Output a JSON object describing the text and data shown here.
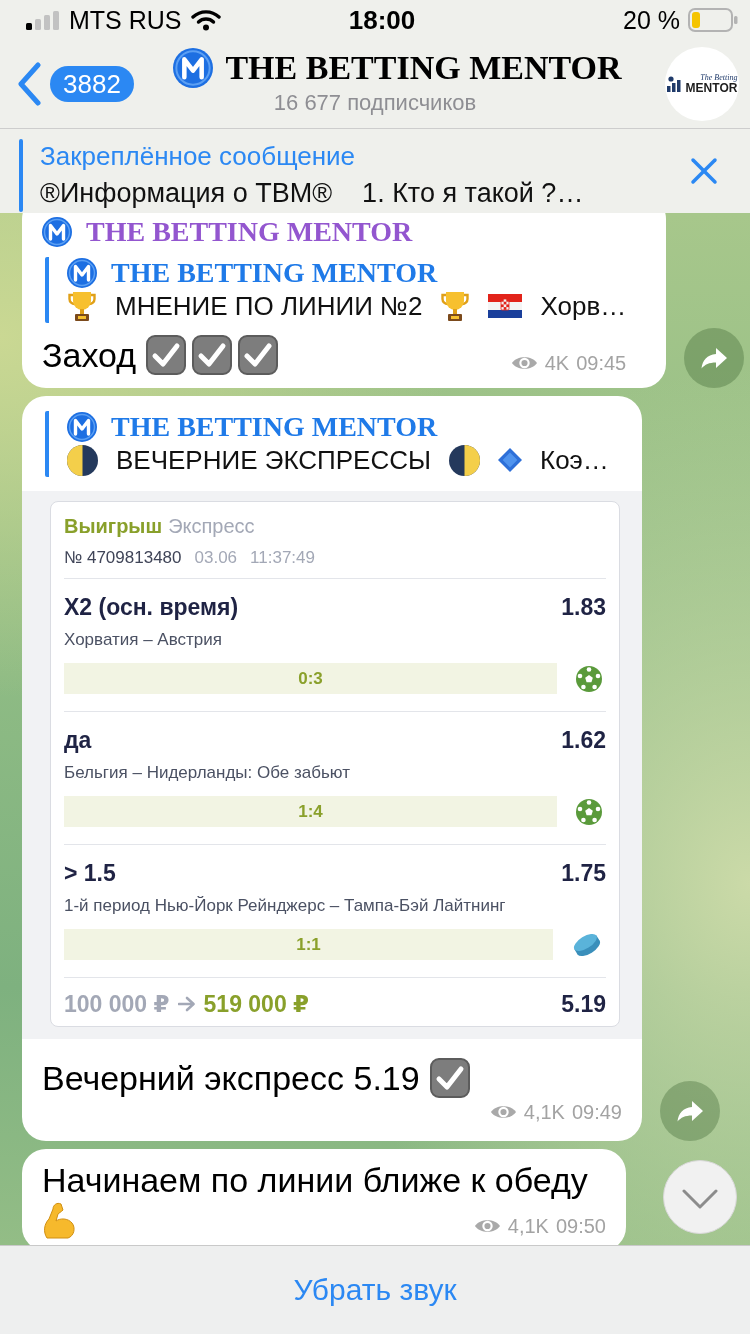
{
  "status_bar": {
    "carrier": "MTS RUS",
    "time": "18:00",
    "battery": "20 %"
  },
  "header": {
    "unread_count": "3882",
    "title": "THE BETTING MENTOR",
    "subtitle": "16 677 подписчиков",
    "avatar": {
      "line_1": "The Betting",
      "line_2": "MENTOR"
    }
  },
  "pinned": {
    "label": "Закреплённое сообщение",
    "text": "®Информация о ТВМ®    1. Кто я такой ?…"
  },
  "messages": [
    {
      "author": "THE BETTING MENTOR",
      "reply": {
        "author": "THE BETTING MENTOR",
        "content": [
          {
            "kind": "trophy"
          },
          {
            "kind": "text",
            "text": "МНЕНИЕ ПО ЛИНИИ №2"
          },
          {
            "kind": "trophy"
          },
          {
            "kind": "flag"
          },
          {
            "kind": "text",
            "text": "Хорв…"
          }
        ]
      },
      "content": [
        {
          "kind": "text",
          "text": "Заход"
        },
        {
          "kind": "check"
        },
        {
          "kind": "check"
        },
        {
          "kind": "check"
        }
      ],
      "views": "4K",
      "time": "09:45",
      "forward_button": true
    },
    {
      "reply": {
        "author": "THE BETTING MENTOR",
        "content": [
          {
            "kind": "waning"
          },
          {
            "kind": "text",
            "text": "ВЕЧЕРНИЕ ЭКСПРЕССЫ"
          },
          {
            "kind": "waxing"
          },
          {
            "kind": "diamond"
          },
          {
            "kind": "text",
            "text": "Коэ…"
          }
        ]
      },
      "slip": {
        "status": "Выигрыш",
        "type": "Экспресс",
        "number": "№ 4709813480",
        "date": "03.06",
        "time": "11:37:49",
        "bets": [
          {
            "pick": "X2 (осн. время)",
            "odds": "1.83",
            "event": "Хорватия – Австрия",
            "score": "0:3",
            "kind": "football"
          },
          {
            "pick": "да",
            "odds": "1.62",
            "event": "Бельгия – Нидерланды: Обе забьют",
            "score": "1:4",
            "kind": "football"
          },
          {
            "pick": "> 1.5",
            "odds": "1.75",
            "event": "1-й период Нью-Йорк Рейнджерс – Тампа-Бэй Лайтнинг",
            "score": "1:1",
            "kind": "hockey"
          }
        ],
        "stake": "100 000 ₽",
        "payout": "519 000 ₽",
        "total_odds": "5.19"
      },
      "content": [
        {
          "kind": "text",
          "text": "Вечерний экспресс 5.19"
        },
        {
          "kind": "check"
        }
      ],
      "views": "4,1K",
      "time": "09:49",
      "forward_button": true
    },
    {
      "content": [
        {
          "kind": "text",
          "text": "Начинаем по линии ближе к обеду"
        },
        {
          "kind": "muscle"
        }
      ],
      "views": "4,1K",
      "time": "09:50"
    }
  ],
  "bottom_bar": {
    "button": "Убрать звук"
  }
}
